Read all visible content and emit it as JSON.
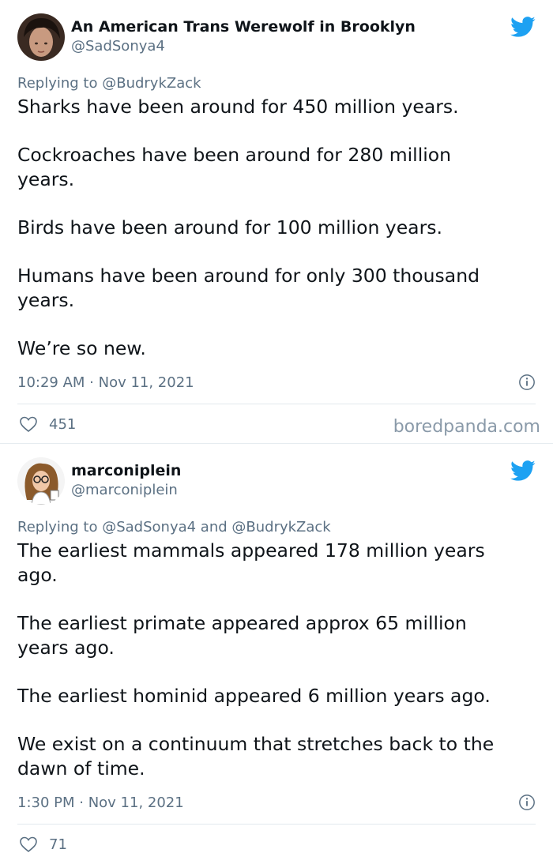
{
  "tweets": [
    {
      "display_name": "An American Trans Werewolf in Brooklyn",
      "handle": "@SadSonya4",
      "reply_prefix": "Replying to",
      "reply_mentions": "@BudrykZack",
      "paragraphs": [
        "Sharks have been around for 450 million years.",
        "Cockroaches have been around for 280 million\nyears.",
        "Birds have been around for 100 million years.",
        "Humans have been around for only 300 thousand\nyears.",
        "We’re so new."
      ],
      "timestamp": "10:29 AM · Nov 11, 2021",
      "likes": "451",
      "bird_icon": "twitter-bird-icon",
      "info_icon": "info-icon",
      "heart_icon": "heart-outline-icon"
    },
    {
      "display_name": "marconiplein",
      "handle": "@marconiplein",
      "reply_prefix": "Replying to",
      "reply_mentions": "@SadSonya4 and @BudrykZack",
      "paragraphs": [
        "The earliest mammals appeared 178 million years\nago.",
        "The earliest primate appeared approx 65 million\nyears ago.",
        "The earliest hominid appeared 6 million years ago.",
        "We exist on a continuum that stretches back to the\ndawn of time."
      ],
      "timestamp": "1:30 PM · Nov 11, 2021",
      "likes": "71",
      "bird_icon": "twitter-bird-icon",
      "info_icon": "info-icon",
      "heart_icon": "heart-outline-icon"
    }
  ],
  "watermark": "boredpanda.com",
  "colors": {
    "twitter_blue": "#1da1f2",
    "secondary_text": "#5b7083"
  }
}
